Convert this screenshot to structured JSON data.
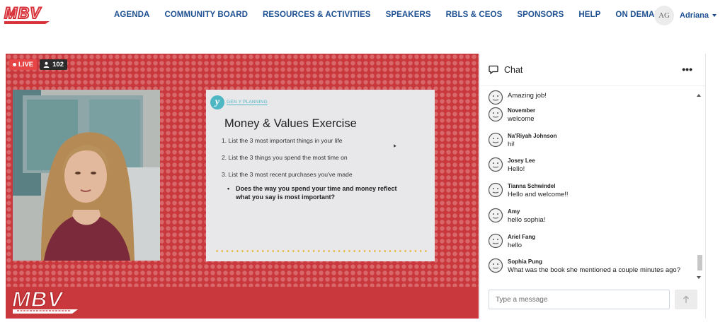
{
  "brand": {
    "logo_text": "MBV",
    "logo_sub": "ELEVATE YOUR BIZ"
  },
  "nav": {
    "items": [
      "AGENDA",
      "COMMUNITY BOARD",
      "RESOURCES & ACTIVITIES",
      "SPEAKERS",
      "RBLS & CEOS",
      "SPONSORS",
      "HELP",
      "ON DEMAND"
    ]
  },
  "user": {
    "initials": "AG",
    "name": "Adriana"
  },
  "stream": {
    "live_label": "LIVE",
    "viewer_count": "102",
    "slide": {
      "brand": "GEN Y PLANNING",
      "title": "Money & Values Exercise",
      "items": [
        "1. List the 3 most important things in your life",
        "2. List the 3 things you spend the most time on",
        "3. List the 3 most recent purchases you've made"
      ],
      "bullet": "Does the way you spend your time and money reflect what you say is most important?"
    },
    "colors": {
      "background": "#c8383c",
      "dots": "#d8686a",
      "slide_dots": "#e3b52e"
    }
  },
  "chat": {
    "title": "Chat",
    "more_label": "•••",
    "messages": [
      {
        "name": "",
        "text": "Amazing job!"
      },
      {
        "name": "November",
        "text": "welcome"
      },
      {
        "name": "Na'Riyah Johnson",
        "text": "hi!"
      },
      {
        "name": "Josey Lee",
        "text": "Hello!"
      },
      {
        "name": "Tianna Schwindel",
        "text": "Hello and welcome!!"
      },
      {
        "name": "Amy",
        "text": "hello sophia!"
      },
      {
        "name": "Ariel Fang",
        "text": "hello"
      },
      {
        "name": "Sophia Pung",
        "text": "What was the book she mentioned a couple minutes ago?"
      }
    ],
    "input_placeholder": "Type a message"
  },
  "colors": {
    "nav_text": "#1d4f91",
    "logo_red": "#d8323a"
  }
}
